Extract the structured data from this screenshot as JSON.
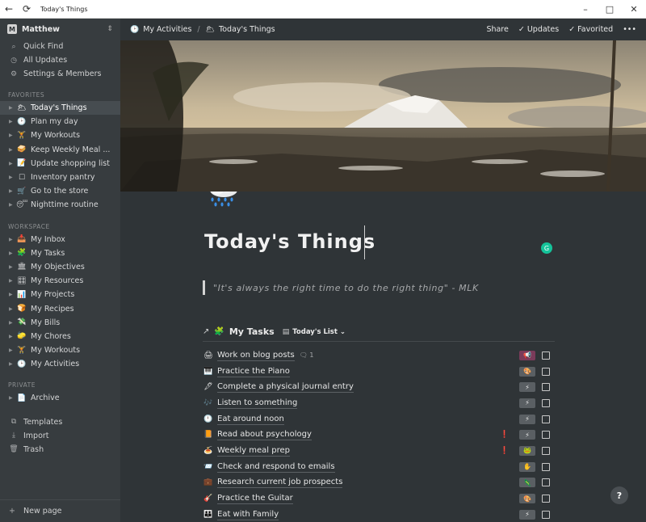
{
  "window": {
    "title": "Today's Things",
    "back_icon": "arrow-left-icon",
    "refresh_icon": "refresh-icon",
    "minimize": "–",
    "maximize": "□",
    "close": "✕"
  },
  "sidebar": {
    "workspace_name": "Matthew",
    "workspace_logo": "M",
    "workspace_switch": "⇕",
    "nav": [
      {
        "icon": "⌕",
        "label": "Quick Find"
      },
      {
        "icon": "◷",
        "label": "All Updates"
      },
      {
        "icon": "⚙",
        "label": "Settings & Members"
      }
    ],
    "favorites_label": "FAVORITES",
    "favorites": [
      {
        "emoji": "🌥",
        "label": "Today's Things",
        "active": true
      },
      {
        "emoji": "🕑",
        "label": "Plan my day"
      },
      {
        "emoji": "🏋",
        "label": "My Workouts"
      },
      {
        "emoji": "🥪",
        "label": "Keep Weekly Meal ..."
      },
      {
        "emoji": "📝",
        "label": "Update shopping list"
      },
      {
        "emoji": "☐",
        "label": "Inventory pantry"
      },
      {
        "emoji": "🛒",
        "label": "Go to the store"
      },
      {
        "emoji": "😴",
        "label": "Nighttime routine"
      }
    ],
    "workspace_label": "WORKSPACE",
    "workspace_pages": [
      {
        "emoji": "📥",
        "label": "My Inbox"
      },
      {
        "emoji": "🧩",
        "label": "My Tasks"
      },
      {
        "emoji": "🏛",
        "label": "My Objectives"
      },
      {
        "emoji": "🎛",
        "label": "My Resources"
      },
      {
        "emoji": "📊",
        "label": "My Projects"
      },
      {
        "emoji": "🍞",
        "label": "My Recipes"
      },
      {
        "emoji": "💸",
        "label": "My Bills"
      },
      {
        "emoji": "🧽",
        "label": "My Chores"
      },
      {
        "emoji": "🏋",
        "label": "My Workouts"
      },
      {
        "emoji": "🕑",
        "label": "My Activities"
      }
    ],
    "private_label": "PRIVATE",
    "private_pages": [
      {
        "emoji": "📄",
        "label": "Archive"
      }
    ],
    "bottom_nav": [
      {
        "icon": "⧉",
        "label": "Templates"
      },
      {
        "icon": "⤓",
        "label": "Import"
      },
      {
        "icon": "🗑",
        "label": "Trash"
      }
    ],
    "new_page": {
      "icon": "+",
      "label": "New page"
    }
  },
  "topbar": {
    "crumbs": [
      {
        "emoji": "🕑",
        "label": "My Activities"
      },
      {
        "emoji": "🌥",
        "label": "Today's Things"
      }
    ],
    "separator": "/",
    "share": "Share",
    "updates": "✓ Updates",
    "favorited": "✓ Favorited",
    "more": "•••"
  },
  "page": {
    "title": "Today's Things",
    "icon": "sun-behind-rain-cloud-icon",
    "quote": "\"It's always the right time to do the right thing\" - MLK",
    "grammarly": "G"
  },
  "database": {
    "link_arrow": "↗",
    "emoji": "🧩",
    "title": "My Tasks",
    "view_icon": "▤",
    "view_label": "Today's List ⌄",
    "rows": [
      {
        "emoji": "🖨",
        "name": "Work on blog posts",
        "comment": "🗨 1",
        "flag": "",
        "tag": "📢",
        "tag_color": "#7a3b5a"
      },
      {
        "emoji": "🎹",
        "name": "Practice the Piano",
        "comment": "",
        "flag": "",
        "tag": "🎨",
        "tag_color": "#5a5f63"
      },
      {
        "emoji": "🖋",
        "name": "Complete a physical journal entry",
        "comment": "",
        "flag": "",
        "tag": "⚡",
        "tag_color": "#5a5f63"
      },
      {
        "emoji": "🎶",
        "name": "Listen to something",
        "comment": "",
        "flag": "",
        "tag": "⚡",
        "tag_color": "#5a5f63"
      },
      {
        "emoji": "🕛",
        "name": "Eat around noon",
        "comment": "",
        "flag": "",
        "tag": "⚡",
        "tag_color": "#5a5f63"
      },
      {
        "emoji": "📙",
        "name": "Read about psychology",
        "comment": "",
        "flag": "❗",
        "tag": "⚡",
        "tag_color": "#5a5f63"
      },
      {
        "emoji": "🍝",
        "name": "Weekly meal prep",
        "comment": "",
        "flag": "❗",
        "tag": "🐸",
        "tag_color": "#5a5f63"
      },
      {
        "emoji": "📨",
        "name": "Check and respond to emails",
        "comment": "",
        "flag": "",
        "tag": "✋",
        "tag_color": "#5a5f63"
      },
      {
        "emoji": "💼",
        "name": "Research current job prospects",
        "comment": "",
        "flag": "",
        "tag": "🦎",
        "tag_color": "#5a5f63"
      },
      {
        "emoji": "🎸",
        "name": "Practice the Guitar",
        "comment": "",
        "flag": "",
        "tag": "🎨",
        "tag_color": "#5a5f63"
      },
      {
        "emoji": "👪",
        "name": "Eat with Family",
        "comment": "",
        "flag": "",
        "tag": "⚡",
        "tag_color": "#5a5f63"
      }
    ]
  },
  "help": "?"
}
